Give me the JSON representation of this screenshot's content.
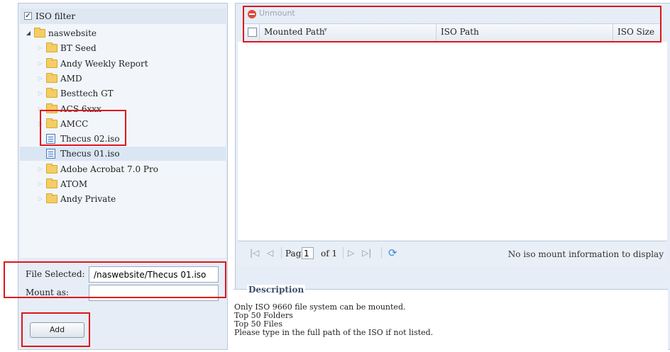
{
  "left": {
    "filter_checked": "✓",
    "filter_label": "ISO filter",
    "tree": [
      {
        "label": "naswebsite",
        "kind": "folder",
        "level": 0,
        "open": true
      },
      {
        "label": "BT Seed",
        "kind": "folder",
        "level": 1
      },
      {
        "label": "Andy Weekly Report",
        "kind": "folder",
        "level": 1
      },
      {
        "label": "AMD",
        "kind": "folder",
        "level": 1
      },
      {
        "label": "Besttech GT",
        "kind": "folder",
        "level": 1
      },
      {
        "label": "ACS 6xxx",
        "kind": "folder",
        "level": 1
      },
      {
        "label": "AMCC",
        "kind": "folder",
        "level": 1
      },
      {
        "label": "Thecus 02.iso",
        "kind": "file",
        "level": 1
      },
      {
        "label": "Thecus 01.iso",
        "kind": "file",
        "level": 1,
        "selected": true
      },
      {
        "label": "Adobe Acrobat 7.0 Pro",
        "kind": "folder",
        "level": 1
      },
      {
        "label": "ATOM",
        "kind": "folder",
        "level": 1
      },
      {
        "label": "Andy Private",
        "kind": "folder",
        "level": 1
      }
    ],
    "file_selected_label": "File Selected:",
    "file_selected_value": "/naswebsite/Thecus 01.iso",
    "mount_as_label": "Mount as:",
    "mount_as_value": "",
    "add_label": "Add"
  },
  "right": {
    "unmount_label": "Unmount",
    "columns": [
      "Mounted Path",
      "ISO Path",
      "ISO Size"
    ],
    "sort_indicator": "▾",
    "pager": {
      "page_label": "Page",
      "page_value": "1",
      "of_label": "of 1",
      "empty_message": "No iso mount information to display"
    },
    "description": {
      "title": "Description",
      "lines": [
        "Only ISO 9660 file system can be mounted.",
        "Top 50 Folders",
        "Top 50 Files",
        "Please type in the full path of the ISO if not listed."
      ]
    }
  },
  "colors": {
    "annotation": "#e0151b",
    "panel": "#e6edf6",
    "selection": "#dbe6f5"
  }
}
